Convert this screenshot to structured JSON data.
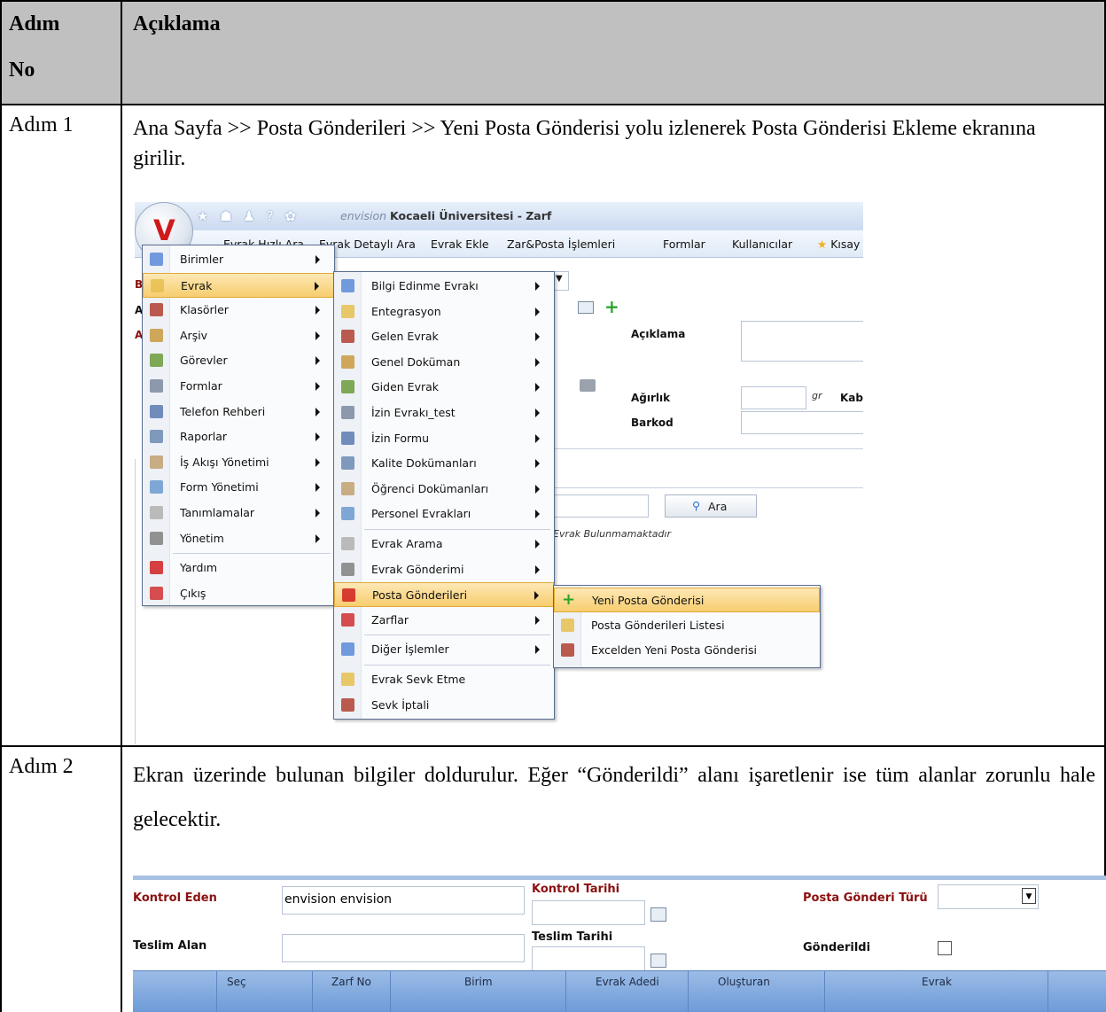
{
  "table": {
    "headers": {
      "step_no": "Adım\n\nNo",
      "description": "Açıklama"
    },
    "rows": [
      {
        "step": "Adım 1",
        "text": "Ana Sayfa >> Posta Gönderileri >> Yeni Posta Gönderisi yolu izlenerek Posta Gönderisi Ekleme ekranına girilir."
      },
      {
        "step": "Adım 2",
        "text": "Ekran üzerinde bulunan bilgiler doldurulur. Eğer “Gönderildi” alanı işaretlenir ise tüm alanlar zorunlu hale gelecektir."
      }
    ]
  },
  "screenshot1": {
    "quick_icons": "★ ☗ ♟ ? ✿",
    "brand_prefix": "envision",
    "brand_title": "Kocaeli Üniversitesi - Zarf",
    "nav": [
      "Evrak Hızlı Ara",
      "Evrak Detaylı Ara",
      "Evrak Ekle",
      "Zar&Posta İşlemleri",
      "Formlar",
      "Kullanıcılar",
      "Kısay"
    ],
    "form": {
      "aciklama": "Açıklama",
      "agirlik": "Ağırlık",
      "gr": "gr",
      "kab": "Kab",
      "barkod": "Barkod",
      "ara_button": "Ara",
      "empty_message": "Evrak Bulunmamaktadır",
      "left_letters": [
        "B",
        "A",
        "A"
      ]
    },
    "main_menu": [
      {
        "label": "Birimler",
        "icon": "folder-icon",
        "arrow": true
      },
      {
        "label": "Evrak",
        "icon": "document-icon",
        "arrow": true,
        "highlighted": true
      },
      {
        "label": "Klasörler",
        "icon": "binders-icon",
        "arrow": true
      },
      {
        "label": "Arşiv",
        "icon": "archive-icon",
        "arrow": true
      },
      {
        "label": "Görevler",
        "icon": "tasks-icon",
        "arrow": true
      },
      {
        "label": "Formlar",
        "icon": "form-icon",
        "arrow": true
      },
      {
        "label": "Telefon Rehberi",
        "icon": "phonebook-icon",
        "arrow": true
      },
      {
        "label": "Raporlar",
        "icon": "report-icon",
        "arrow": true
      },
      {
        "label": "İş Akışı Yönetimi",
        "icon": "workflow-icon",
        "arrow": true
      },
      {
        "label": "Form Yönetimi",
        "icon": "form-manage-icon",
        "arrow": true
      },
      {
        "label": "Tanımlamalar",
        "icon": "definitions-icon",
        "arrow": true
      },
      {
        "label": "Yönetim",
        "icon": "tools-icon",
        "arrow": true
      },
      {
        "label": "Yardım",
        "icon": "help-icon",
        "arrow": false
      },
      {
        "label": "Çıkış",
        "icon": "power-icon",
        "arrow": false
      }
    ],
    "evrak_menu": [
      {
        "label": "Bilgi Edinme Evrakı",
        "arrow": true
      },
      {
        "label": "Entegrasyon",
        "arrow": true
      },
      {
        "label": "Gelen Evrak",
        "arrow": true
      },
      {
        "label": "Genel Doküman",
        "arrow": true
      },
      {
        "label": "Giden Evrak",
        "arrow": true
      },
      {
        "label": "İzin Evrakı_test",
        "arrow": true
      },
      {
        "label": "İzin Formu",
        "arrow": true
      },
      {
        "label": "Kalite Dokümanları",
        "arrow": true
      },
      {
        "label": "Öğrenci Dokümanları",
        "arrow": true
      },
      {
        "label": "Personel Evrakları",
        "arrow": true
      },
      {
        "label": "Evrak Arama",
        "arrow": true
      },
      {
        "label": "Evrak Gönderimi",
        "arrow": true
      },
      {
        "label": "Posta Gönderileri",
        "arrow": true,
        "highlighted": true
      },
      {
        "label": "Zarflar",
        "arrow": true
      },
      {
        "label": "Diğer İşlemler",
        "arrow": true
      },
      {
        "label": "Evrak Sevk Etme",
        "arrow": false
      },
      {
        "label": "Sevk İptali",
        "arrow": false
      }
    ],
    "posta_menu": [
      {
        "label": "Yeni Posta Gönderisi",
        "highlighted": true
      },
      {
        "label": "Posta Gönderileri Listesi"
      },
      {
        "label": "Excelden Yeni Posta Gönderisi"
      }
    ]
  },
  "screenshot2": {
    "kontrol_eden_label": "Kontrol Eden",
    "kontrol_eden_value": "envision envision",
    "kontrol_tarihi_label": "Kontrol Tarihi",
    "posta_turu_label": "Posta Gönderi Türü",
    "teslim_alan_label": "Teslim Alan",
    "teslim_tarihi_label": "Teslim Tarihi",
    "gonderildi_label": "Gönderildi",
    "columns": [
      "Seç",
      "Zarf No",
      "Birim",
      "Evrak Adedi",
      "Oluşturan",
      "Evrak"
    ]
  },
  "colors": {
    "header_bg": "#c0c0c0",
    "menu_highlight": "#f7cd6e",
    "label_red": "#8b1010",
    "grid_header": "#7aa3dc"
  }
}
